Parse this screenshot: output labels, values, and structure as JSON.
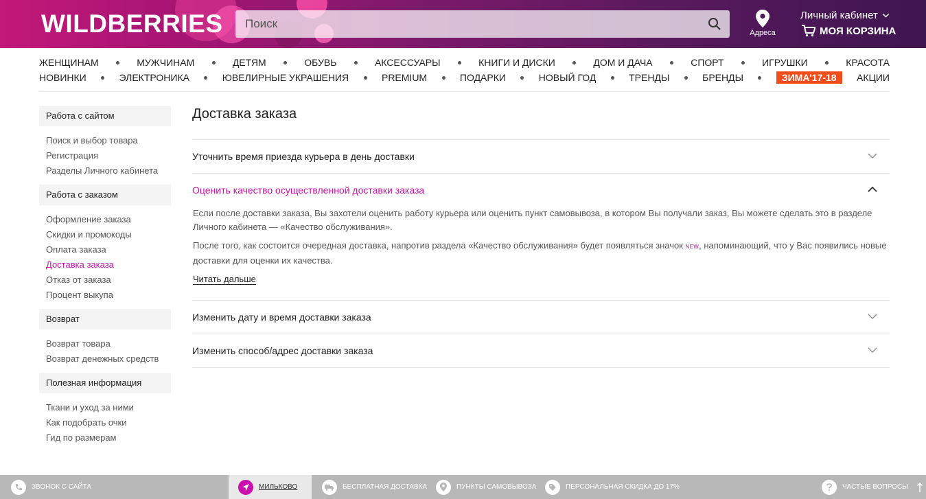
{
  "header": {
    "logo": "WILDBERRIES",
    "search_placeholder": "Поиск",
    "address_label": "Адреса",
    "cabinet_label": "Личный кабинет",
    "cart_label": "МОЯ КОРЗИНА"
  },
  "categories_row1": [
    "ЖЕНЩИНАМ",
    "МУЖЧИНАМ",
    "ДЕТЯМ",
    "ОБУВЬ",
    "АКСЕССУАРЫ",
    "КНИГИ И ДИСКИ",
    "ДОМ И ДАЧА",
    "СПОРТ",
    "ИГРУШКИ",
    "КРАСОТА"
  ],
  "categories_row2": [
    "НОВИНКИ",
    "ЭЛЕКТРОНИКА",
    "ЮВЕЛИРНЫЕ УКРАШЕНИЯ",
    "PREMIUM",
    "ПОДАРКИ",
    "НОВЫЙ ГОД",
    "ТРЕНДЫ",
    "БРЕНДЫ",
    "ЗИМА'17-18",
    "АКЦИИ"
  ],
  "sidebar": {
    "sections": [
      {
        "title": "Работа с сайтом",
        "items": [
          "Поиск и выбор товара",
          "Регистрация",
          "Разделы Личного кабинета"
        ]
      },
      {
        "title": "Работа с заказом",
        "items": [
          "Оформление заказа",
          "Скидки и промокоды",
          "Оплата заказа",
          "Доставка заказа",
          "Отказ от заказа",
          "Процент выкупа"
        ]
      },
      {
        "title": "Возврат",
        "items": [
          "Возврат товара",
          "Возврат денежных средств"
        ]
      },
      {
        "title": "Полезная информация",
        "items": [
          "Ткани и уход за ними",
          "Как подобрать очки",
          "Гид по размерам"
        ]
      }
    ],
    "active_item": "Доставка заказа"
  },
  "main": {
    "title": "Доставка заказа",
    "faq": [
      {
        "question": "Уточнить время приезда курьера в день доставки"
      },
      {
        "question": "Оценить качество осуществленной доставки заказа",
        "answer_p1": "Если после доставки заказа, Вы захотели оценить работу курьера или оценить пункт самовывоза, в котором Вы получали заказ, Вы можете сделать это в разделе Личного кабинета — «Качество обслуживания».",
        "answer_p2_before": "После того, как состоится очередная доставка, напротив раздела «Качество обслуживания» будет появляться значок ",
        "answer_p2_badge": "NEW",
        "answer_p2_after": ", напоминающий, что у Вас появились новые доставки для оценки их качества.",
        "read_more": "Читать дальше"
      },
      {
        "question": "Изменить дату и время доставки заказа"
      },
      {
        "question": "Изменить способ/адрес доставки заказа"
      }
    ]
  },
  "footer": {
    "call": "ЗВОНОК С САЙТА",
    "city": "МИЛЬКОВО",
    "free_delivery": "БЕСПЛАТНАЯ ДОСТАВКА",
    "pickup": "ПУНКТЫ САМОВЫВОЗА",
    "discount": "ПЕРСОНАЛЬНАЯ СКИДКА ДО 17%",
    "faq": "ЧАСТЫЕ ВОПРОСЫ"
  },
  "colors": {
    "accent": "#cb11ab",
    "promo": "#f04d1a"
  }
}
